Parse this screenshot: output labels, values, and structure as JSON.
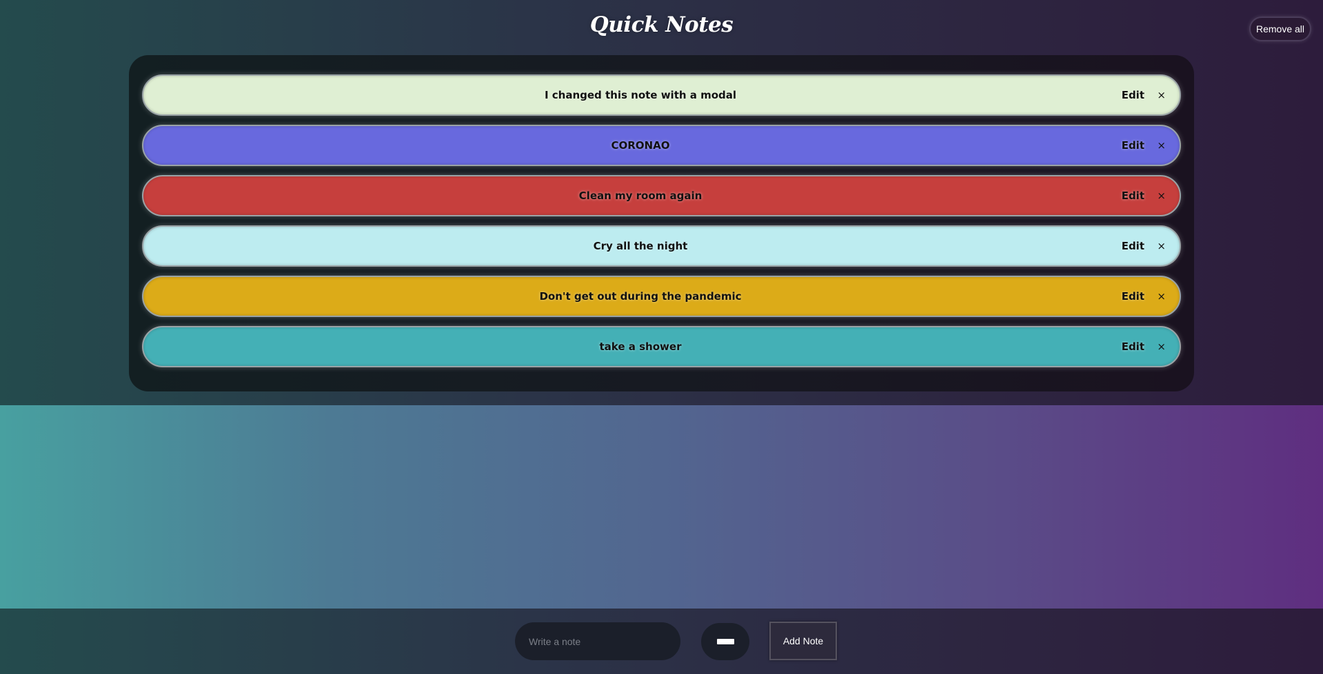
{
  "app": {
    "title": "Quick Notes"
  },
  "header": {
    "remove_all_label": "Remove all"
  },
  "notes": [
    {
      "text": "I changed this note with a modal",
      "edit_label": "Edit",
      "close_label": "×",
      "color": "#dfefd3"
    },
    {
      "text": "CORONAO",
      "edit_label": "Edit",
      "close_label": "×",
      "color": "#6869de"
    },
    {
      "text": "Clean my room again",
      "edit_label": "Edit",
      "close_label": "×",
      "color": "#c63f3d"
    },
    {
      "text": "Cry all the night",
      "edit_label": "Edit",
      "close_label": "×",
      "color": "#bdecf0"
    },
    {
      "text": "Don't get out during the pandemic",
      "edit_label": "Edit",
      "close_label": "×",
      "color": "#dcab18"
    },
    {
      "text": "take a shower",
      "edit_label": "Edit",
      "close_label": "×",
      "color": "#44b0b6"
    }
  ],
  "composer": {
    "input_placeholder": "Write a note",
    "input_value": "",
    "color_picker_value": "#ffffff",
    "add_label": "Add Note"
  },
  "colors": {
    "panel": "#151a20",
    "input_bg": "#1b1f2a"
  }
}
